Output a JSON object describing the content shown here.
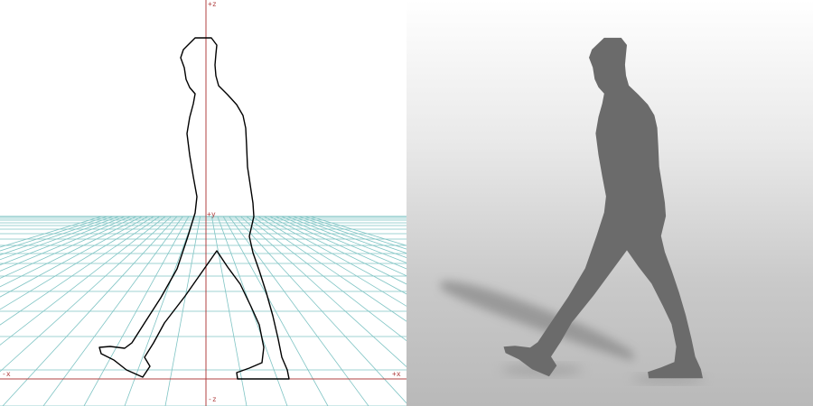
{
  "viewport": {
    "axes": {
      "pos_z": "+z",
      "neg_z": "-z",
      "pos_y": "+y",
      "neg_x": "-x",
      "pos_x": "+x"
    }
  },
  "colors": {
    "grid": "#7fc4c4",
    "axis": "#b04040",
    "outline": "#000000",
    "silhouette": "#6b6b6b",
    "shadow": "#8a8a8a"
  }
}
